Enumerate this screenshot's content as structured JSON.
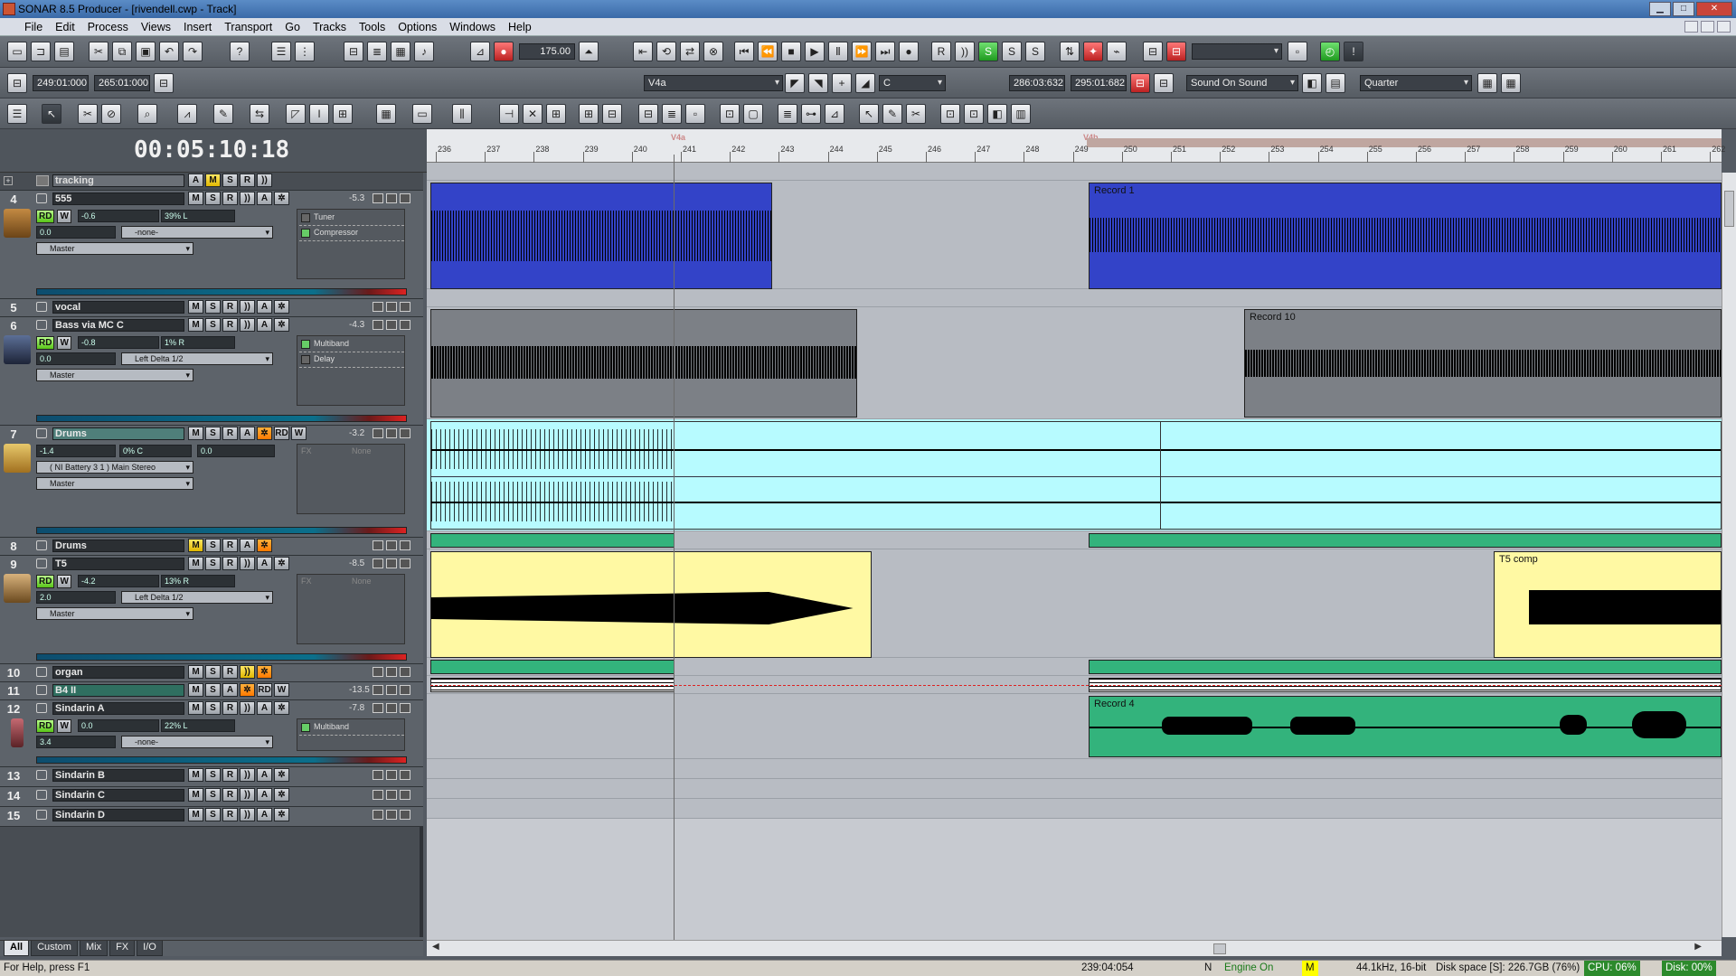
{
  "window": {
    "title": "SONAR 8.5 Producer - [rivendell.cwp - Track]"
  },
  "menu": [
    "File",
    "Edit",
    "Process",
    "Views",
    "Insert",
    "Transport",
    "Go",
    "Tracks",
    "Tools",
    "Options",
    "Windows",
    "Help"
  ],
  "toolbar": {
    "tempo": "175.00",
    "loop_start": "249:01:000",
    "loop_end": "265:01:000",
    "marker_select": "V4a",
    "key_select": "C",
    "punch_start": "286:03:632",
    "punch_end": "295:01:682",
    "record_mode": "Sound On Sound",
    "snap": "Quarter"
  },
  "clock": "00:05:10:18",
  "ruler": {
    "bars": [
      "236",
      "237",
      "238",
      "239",
      "240",
      "241",
      "242",
      "243",
      "244",
      "245",
      "246",
      "247",
      "248",
      "249",
      "250",
      "251",
      "252",
      "253",
      "254",
      "255",
      "256",
      "257",
      "258",
      "259",
      "260",
      "261",
      "262"
    ],
    "markers": [
      "V4a",
      "V4b"
    ]
  },
  "folder": {
    "name": "tracking"
  },
  "tracks": [
    {
      "num": "4",
      "name": "555",
      "vol": "-5.3",
      "pan_vol": "-0.6",
      "pan": "39% L",
      "trim": "0.0",
      "input": "-none-",
      "output": "Master",
      "fx": [
        "Tuner",
        "Compressor"
      ]
    },
    {
      "num": "5",
      "name": "vocal"
    },
    {
      "num": "6",
      "name": "Bass via MC C",
      "vol": "-4.3",
      "pan_vol": "-0.8",
      "pan": "1% R",
      "trim": "0.0",
      "input": "Left Delta 1/2",
      "output": "Master",
      "fx": [
        "Multiband",
        "Delay"
      ]
    },
    {
      "num": "7",
      "name": "Drums",
      "vol": "-3.2",
      "pan_vol": "-1.4",
      "pan": "0% C",
      "trim": "0.0",
      "input": "( NI Battery 3 1 ) Main Stereo",
      "output": "Master",
      "fx_label": "FX",
      "fx_none": "None"
    },
    {
      "num": "8",
      "name": "Drums"
    },
    {
      "num": "9",
      "name": "T5",
      "vol": "-8.5",
      "pan_vol": "-4.2",
      "pan": "13% R",
      "trim": "2.0",
      "input": "Left Delta 1/2",
      "output": "Master",
      "fx_label": "FX",
      "fx_none": "None"
    },
    {
      "num": "10",
      "name": "organ"
    },
    {
      "num": "11",
      "name": "B4 II",
      "vol": "-13.5"
    },
    {
      "num": "12",
      "name": "Sindarin A",
      "vol": "-7.8",
      "pan_vol": "0.0",
      "pan": "22% L",
      "trim": "3.4",
      "input": "-none-",
      "fx": [
        "Multiband"
      ]
    },
    {
      "num": "13",
      "name": "Sindarin B"
    },
    {
      "num": "14",
      "name": "Sindarin C"
    },
    {
      "num": "15",
      "name": "Sindarin D"
    }
  ],
  "clips": {
    "record1": "Record 1",
    "record10": "Record 10",
    "t5comp": "T5 comp",
    "record4": "Record 4"
  },
  "tabs": [
    "All",
    "Custom",
    "Mix",
    "FX",
    "I/O"
  ],
  "status": {
    "help": "For Help, press F1",
    "position": "239:04:054",
    "n": "N",
    "engine": "Engine On",
    "m": "M",
    "format": "44.1kHz, 16-bit",
    "disk": "Disk space [S]: 226.7GB (76%)",
    "cpu": "CPU: 06%",
    "disk_load": "Disk: 00%"
  },
  "colors": {
    "audio_blue": "#3343c8",
    "audio_gray": "#7c8086",
    "drums_cyan": "#b7fbff",
    "t5_yellow": "#fff9a3",
    "green": "#33b37c"
  }
}
